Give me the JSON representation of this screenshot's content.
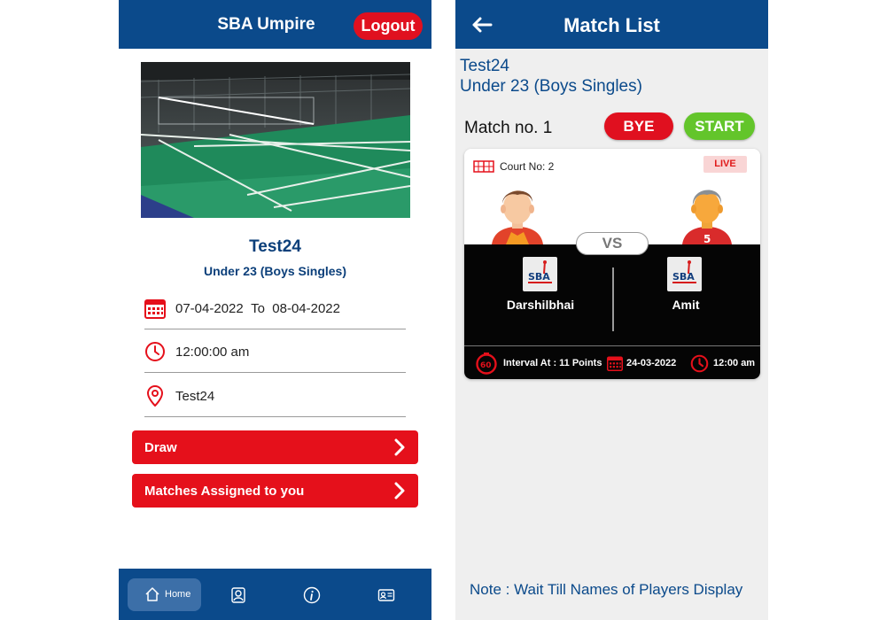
{
  "left": {
    "header": {
      "title": "SBA Umpire",
      "logout_label": "Logout"
    },
    "event": {
      "name": "Test24",
      "category": "Under 23 (Boys Singles)"
    },
    "details": {
      "start_date": "07-04-2022",
      "to_label": "To",
      "end_date": "08-04-2022",
      "time": "12:00:00 am",
      "venue": "Test24"
    },
    "buttons": {
      "draw": "Draw",
      "matches": "Matches Assigned to you"
    },
    "nav": {
      "home": "Home"
    }
  },
  "right": {
    "header": {
      "title": "Match List"
    },
    "event": {
      "name": "Test24",
      "category": "Under 23 (Boys Singles)"
    },
    "match": {
      "number_label": "Match no. 1",
      "bye_label": "BYE",
      "start_label": "START",
      "court": "Court No: 2",
      "status": "LIVE",
      "vs": "VS",
      "player1": "Darshilbhai",
      "player2": "Amit",
      "logo_text": "SBA",
      "interval": "Interval At : 11 Points",
      "interval_badge": "60",
      "date": "24-03-2022",
      "time": "12:00 am"
    },
    "note": "Note : Wait Till Names of Players Display"
  },
  "colors": {
    "header_blue": "#0b4a8b",
    "red": "#e5101b",
    "green": "#63c52b",
    "text_blue": "#0b3f7a"
  }
}
